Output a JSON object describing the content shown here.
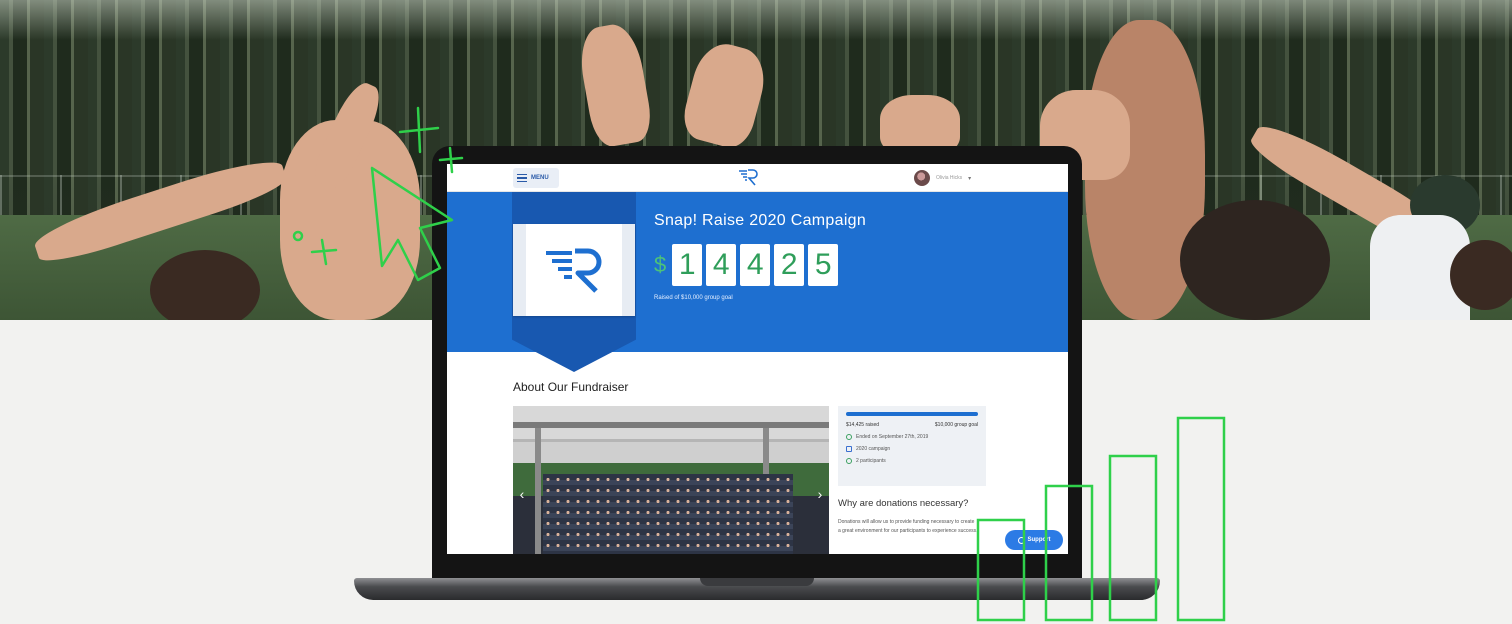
{
  "screen_header": {
    "menu_label": "MENU",
    "user_name": "Olivia Hicks"
  },
  "campaign": {
    "title": "Snap! Raise 2020 Campaign",
    "currency_symbol": "$",
    "amount_digits": [
      "1",
      "4",
      "4",
      "2",
      "5"
    ],
    "goal_text": "Raised of $10,000 group goal"
  },
  "about": {
    "title": "About Our Fundraiser"
  },
  "stats": {
    "progress_percent": 100,
    "raised_label": "$14,425 raised",
    "goal_label": "$10,000 group goal",
    "ended_text": "Ended on September 27th, 2019",
    "campaign_text": "2020 campaign",
    "participants_text": "2 participants"
  },
  "why": {
    "title": "Why are donations necessary?",
    "body": "Donations will allow us to provide funding necessary to create a great environment for our participants to experience success."
  },
  "support_button": {
    "label": "Support"
  },
  "carousel": {
    "prev_glyph": "‹",
    "next_glyph": "›"
  },
  "colors": {
    "brand_blue": "#1e6fd0",
    "doodle_green": "#2fd04a",
    "digit_green": "#2f9e5a"
  },
  "icons": {
    "brand": "snap-raise-r-logo",
    "cursor_doodle": "cursor-arrow-icon",
    "bar_doodle": "bar-chart-icon"
  }
}
